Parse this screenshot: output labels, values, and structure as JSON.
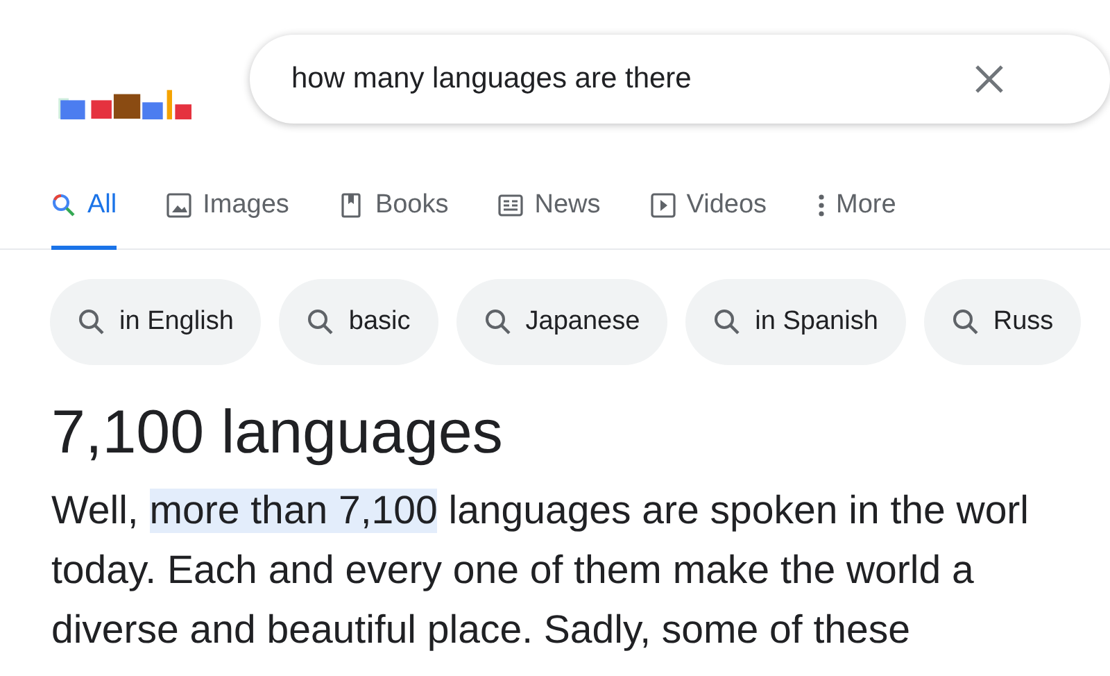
{
  "search": {
    "value": "how many languages are there"
  },
  "tabs": [
    {
      "label": "All",
      "selected": true
    },
    {
      "label": "Images",
      "selected": false
    },
    {
      "label": "Books",
      "selected": false
    },
    {
      "label": "News",
      "selected": false
    },
    {
      "label": "Videos",
      "selected": false
    },
    {
      "label": "More",
      "selected": false
    }
  ],
  "chips": [
    "in English",
    "basic",
    "Japanese",
    "in Spanish",
    "Russ"
  ],
  "answer": {
    "title": "7,100 languages",
    "lines": [
      [
        {
          "text": "Well, ",
          "highlighted": false
        },
        {
          "text": "more than 7,100",
          "highlighted": true
        },
        {
          "text": " languages are spoken in the worl",
          "highlighted": false
        }
      ],
      [
        {
          "text": "today. Each and every one of them make the world a",
          "highlighted": false
        }
      ],
      [
        {
          "text": "diverse and beautiful place. Sadly, some of these",
          "highlighted": false
        }
      ]
    ]
  }
}
